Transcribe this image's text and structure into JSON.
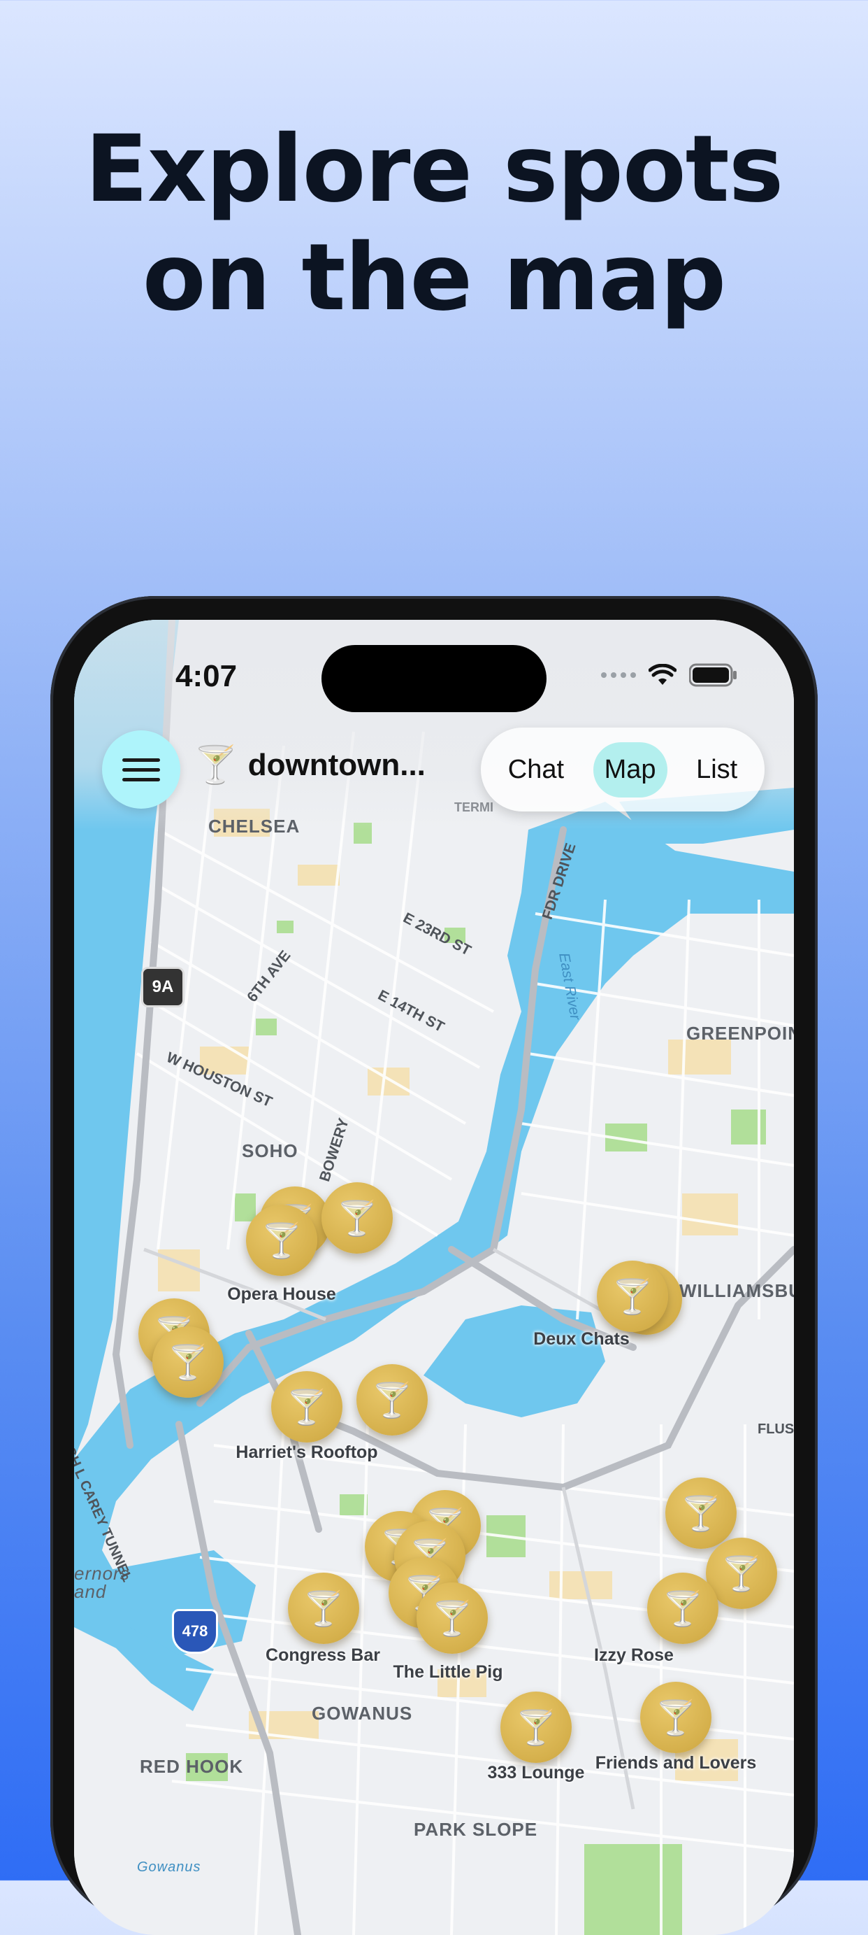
{
  "headline": {
    "line1": "Explore spots",
    "line2": "on the map"
  },
  "status_bar": {
    "time": "4:07"
  },
  "header": {
    "title_icon": "cocktail-glass-icon",
    "title": "downtown...",
    "tabs": [
      {
        "label": "Chat",
        "active": false
      },
      {
        "label": "Map",
        "active": true
      },
      {
        "label": "List",
        "active": false
      }
    ]
  },
  "map": {
    "neighborhoods": [
      "CHELSEA",
      "SOHO",
      "GREENPOINT",
      "WILLIAMSBU",
      "GOWANUS",
      "RED HOOK",
      "PARK SLOPE",
      "ernors",
      "and",
      "Gowanus"
    ],
    "streets": [
      "E 23RD ST",
      "6TH AVE",
      "E 14TH ST",
      "W HOUSTON ST",
      "BOWERY",
      "FDR DRIVE",
      "East River",
      "HUGH L CAREY TUNNEL",
      "FLUS",
      "TERMI"
    ],
    "shields": {
      "route_9a": "9A",
      "interstate_478": "478"
    },
    "venues": [
      "Opera House",
      "Deux Chats",
      "Harriet's Rooftop",
      "Congress Bar",
      "The Little Pig",
      "Izzy Rose",
      "333 Lounge",
      "Friends and Lovers"
    ],
    "colors": {
      "water": "#6fc7ee",
      "land": "#eef0f3",
      "park": "#a6dc8a",
      "pin": "#d5b04c",
      "menu_button": "#aef4fb"
    }
  }
}
